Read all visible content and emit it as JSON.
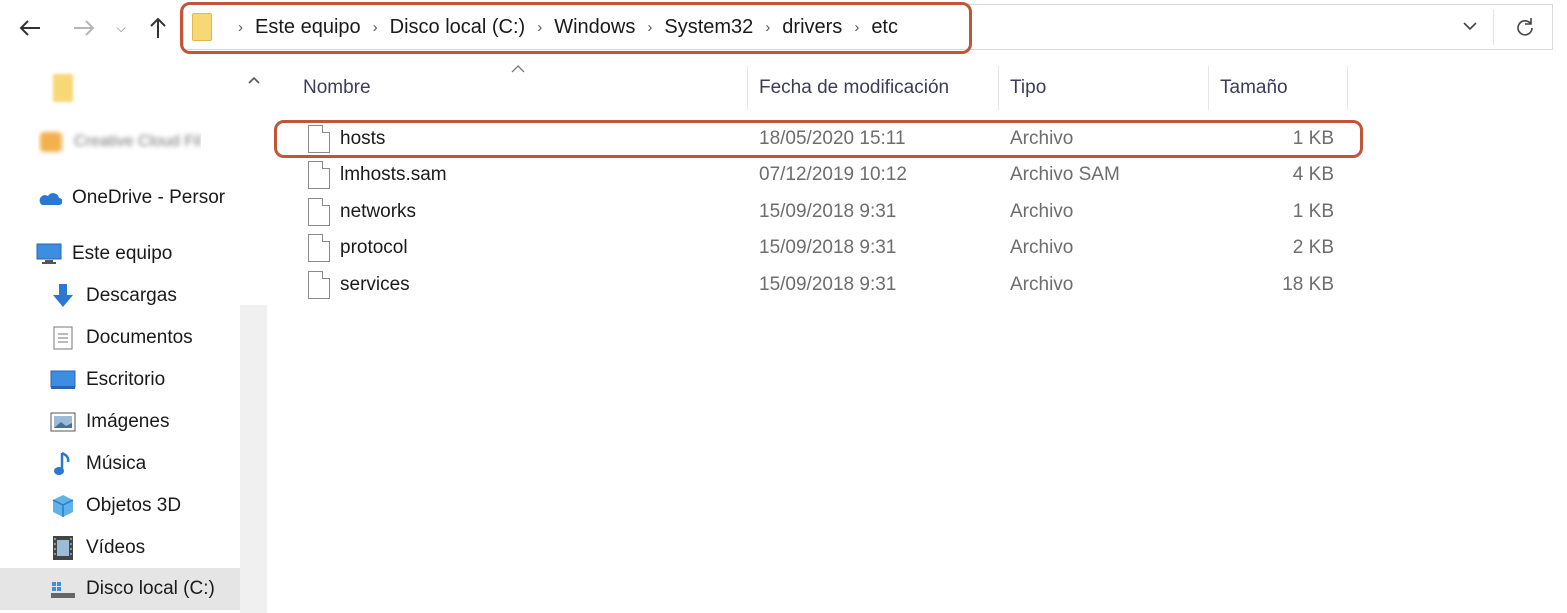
{
  "address": {
    "breadcrumbs": [
      "Este equipo",
      "Disco local (C:)",
      "Windows",
      "System32",
      "drivers",
      "etc"
    ],
    "dropdown_icon": "chevron-down-icon",
    "refresh_icon": "refresh-icon"
  },
  "nav": {
    "back_icon": "arrow-left-icon",
    "forward_icon": "arrow-right-icon",
    "recent_icon": "chevron-down-icon",
    "up_icon": "arrow-up-icon"
  },
  "sidebar": {
    "items": [
      {
        "label": "",
        "icon": "folder-icon"
      },
      {
        "label": "Creative Cloud Fil",
        "icon": "creative-cloud-icon"
      },
      {
        "label": "OneDrive - Persor",
        "icon": "cloud-icon"
      },
      {
        "label": "Este equipo",
        "icon": "computer-icon"
      },
      {
        "label": "Descargas",
        "icon": "download-icon"
      },
      {
        "label": "Documentos",
        "icon": "document-icon"
      },
      {
        "label": "Escritorio",
        "icon": "desktop-icon"
      },
      {
        "label": "Imágenes",
        "icon": "pictures-icon"
      },
      {
        "label": "Música",
        "icon": "music-icon"
      },
      {
        "label": "Objetos 3D",
        "icon": "cube-icon"
      },
      {
        "label": "Vídeos",
        "icon": "video-icon"
      },
      {
        "label": "Disco local (C:)",
        "icon": "drive-icon"
      }
    ]
  },
  "columns": {
    "name": "Nombre",
    "modified": "Fecha de modificación",
    "type": "Tipo",
    "size": "Tamaño"
  },
  "files": [
    {
      "name": "hosts",
      "modified": "18/05/2020 15:11",
      "type": "Archivo",
      "size": "1 KB"
    },
    {
      "name": "lmhosts.sam",
      "modified": "07/12/2019 10:12",
      "type": "Archivo SAM",
      "size": "4 KB"
    },
    {
      "name": "networks",
      "modified": "15/09/2018 9:31",
      "type": "Archivo",
      "size": "1 KB"
    },
    {
      "name": "protocol",
      "modified": "15/09/2018 9:31",
      "type": "Archivo",
      "size": "2 KB"
    },
    {
      "name": "services",
      "modified": "15/09/2018 9:31",
      "type": "Archivo",
      "size": "18 KB"
    }
  ],
  "colors": {
    "highlight": "#c0553a",
    "folder": "#f8d775",
    "selected_bg": "#e5e5e5"
  }
}
